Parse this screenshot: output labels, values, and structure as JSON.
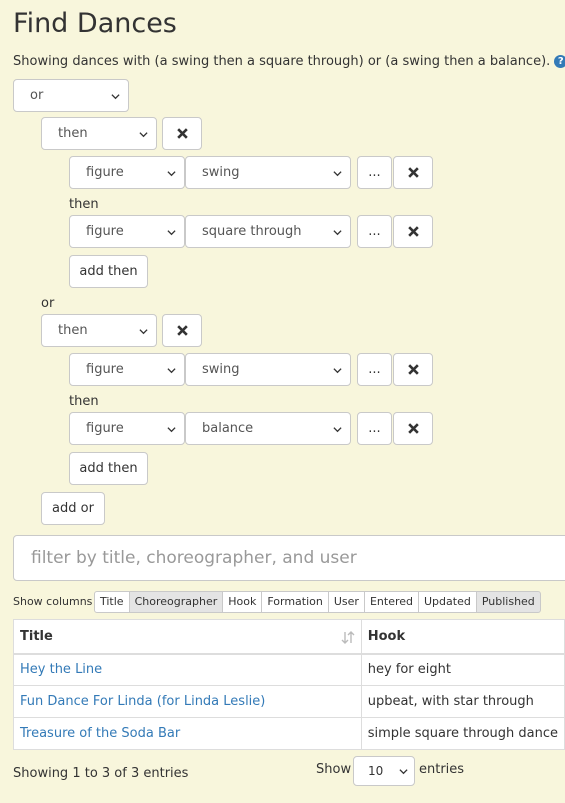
{
  "page": {
    "title": "Find Dances",
    "summary": "Showing dances with (a swing then a square through) or (a swing then a balance).",
    "help_icon": "question-circle-icon"
  },
  "query": {
    "root_op": "or",
    "groups": [
      {
        "op": "then",
        "remove_icon": "close-icon",
        "figures": [
          {
            "type": "figure",
            "value": "swing",
            "more_label": "..."
          },
          {
            "type": "figure",
            "value": "square through",
            "more_label": "..."
          }
        ],
        "joiner": "then",
        "add_label": "add then"
      },
      {
        "op": "then",
        "remove_icon": "close-icon",
        "figures": [
          {
            "type": "figure",
            "value": "swing",
            "more_label": "..."
          },
          {
            "type": "figure",
            "value": "balance",
            "more_label": "..."
          }
        ],
        "joiner": "then",
        "add_label": "add then"
      }
    ],
    "group_joiner": "or",
    "add_or_label": "add or"
  },
  "search": {
    "placeholder": "filter by title, choreographer, and user"
  },
  "columns": {
    "label": "Show columns",
    "buttons": [
      {
        "label": "Title",
        "active": false
      },
      {
        "label": "Choreographer",
        "active": true
      },
      {
        "label": "Hook",
        "active": false
      },
      {
        "label": "Formation",
        "active": false
      },
      {
        "label": "User",
        "active": false
      },
      {
        "label": "Entered",
        "active": false
      },
      {
        "label": "Updated",
        "active": false
      },
      {
        "label": "Published",
        "active": true
      }
    ]
  },
  "table": {
    "headers": [
      "Title",
      "Hook"
    ],
    "rows": [
      {
        "title": "Hey the Line",
        "hook": "hey for eight"
      },
      {
        "title": "Fun Dance For Linda (for Linda Leslie)",
        "hook": "upbeat, with star through"
      },
      {
        "title": "Treasure of the Soda Bar",
        "hook": "simple square through dance"
      }
    ]
  },
  "footer": {
    "info": "Showing 1 to 3 of 3 entries",
    "show_label": "Show",
    "page_length": "10",
    "entries_label": "entries"
  },
  "colors": {
    "background": "#f8f6dc",
    "link": "#337ab7",
    "active_column": "#e4e4e4"
  }
}
